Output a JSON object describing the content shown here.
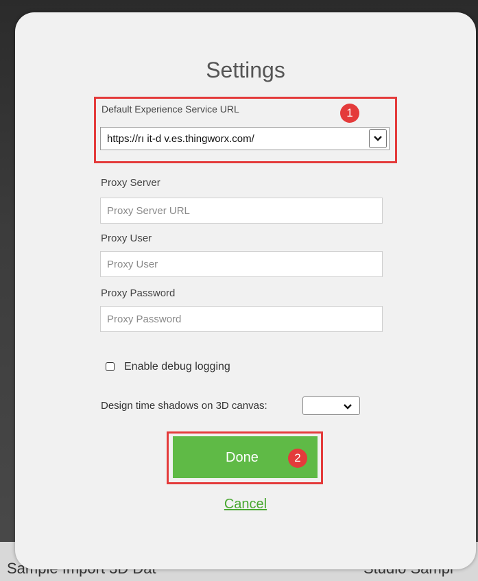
{
  "background": {
    "left_text": "Sample Import 3D Dat",
    "right_text": "Studio Sampl"
  },
  "dialog": {
    "title": "Settings",
    "experience_service": {
      "label": "Default Experience Service URL",
      "value": "https://rı  it-d  v.es.thingworx.com/"
    },
    "proxy_server": {
      "label": "Proxy Server",
      "placeholder": "Proxy Server URL"
    },
    "proxy_user": {
      "label": "Proxy User",
      "placeholder": "Proxy User"
    },
    "proxy_password": {
      "label": "Proxy Password",
      "placeholder": "Proxy Password"
    },
    "debug_logging": {
      "label": "Enable debug logging",
      "checked": false
    },
    "design_shadows": {
      "label": "Design time shadows on 3D canvas:",
      "value": ""
    },
    "done_label": "Done",
    "cancel_label": "Cancel"
  },
  "annotations": {
    "badge_1": "1",
    "badge_2": "2",
    "color": "#e43b3b"
  },
  "colors": {
    "primary_button": "#5fba46",
    "link": "#4aa832"
  },
  "icons": {
    "dropdown": "chevron-down-icon",
    "checkbox": "checkbox-unchecked-icon"
  }
}
